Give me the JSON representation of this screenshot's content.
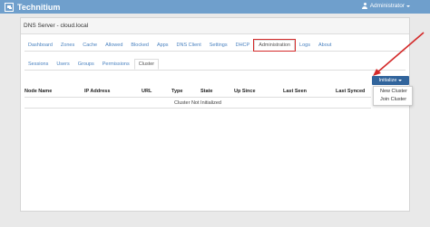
{
  "app": {
    "name": "Technitium"
  },
  "user": {
    "label": "Administrator"
  },
  "panel": {
    "title": "DNS Server - cloud.local"
  },
  "main_tabs": [
    "Dashboard",
    "Zones",
    "Cache",
    "Allowed",
    "Blocked",
    "Apps",
    "DNS Client",
    "Settings",
    "DHCP",
    "Administration",
    "Logs",
    "About"
  ],
  "main_tab_active": "Administration",
  "sub_tabs": [
    "Sessions",
    "Users",
    "Groups",
    "Permissions",
    "Cluster"
  ],
  "sub_tab_active": "Cluster",
  "init_button": {
    "label": "Initialize"
  },
  "dropdown": {
    "items": [
      "New Cluster",
      "Join Cluster"
    ]
  },
  "table": {
    "columns": [
      "Node Name",
      "IP Address",
      "URL",
      "Type",
      "State",
      "Up Since",
      "Last Seen",
      "Last Synced"
    ],
    "empty_message": "Cluster Not Initialized"
  },
  "colors": {
    "navbar": "#6f9fcc",
    "link": "#4a82c0",
    "button": "#31649c",
    "highlight": "#d42a2a"
  }
}
